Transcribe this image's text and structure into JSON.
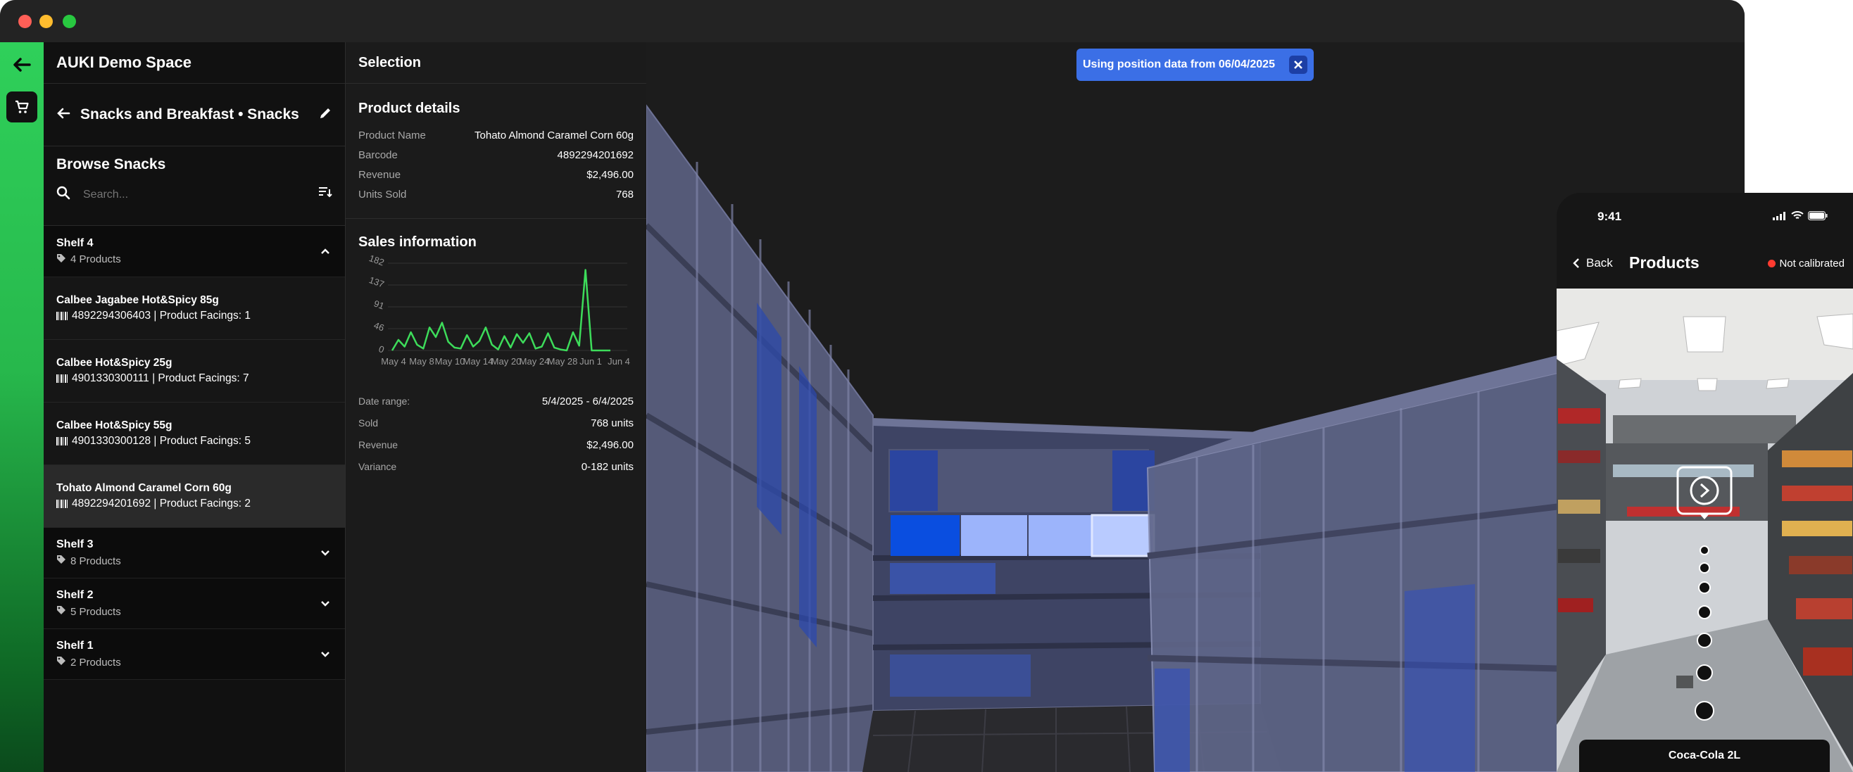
{
  "app": {
    "space_name": "AUKI Demo Space"
  },
  "category": {
    "title": "Snacks and Breakfast • Snacks"
  },
  "browse": {
    "title": "Browse Snacks",
    "search_placeholder": "Search..."
  },
  "shelves": [
    {
      "name": "Shelf 4",
      "count": "4 Products",
      "expanded": true,
      "products": [
        {
          "name": "Calbee Jagabee Hot&Spicy 85g",
          "meta": "4892294306403 | Product Facings: 1"
        },
        {
          "name": "Calbee Hot&Spicy 25g",
          "meta": "4901330300111 | Product Facings: 7"
        },
        {
          "name": "Calbee Hot&Spicy 55g",
          "meta": "4901330300128 | Product Facings: 5"
        },
        {
          "name": "Tohato Almond Caramel Corn 60g",
          "meta": "4892294201692 | Product Facings: 2"
        }
      ]
    },
    {
      "name": "Shelf 3",
      "count": "8 Products",
      "expanded": false
    },
    {
      "name": "Shelf 2",
      "count": "5 Products",
      "expanded": false
    },
    {
      "name": "Shelf 1",
      "count": "2 Products",
      "expanded": false
    }
  ],
  "selection": {
    "header": "Selection",
    "details_title": "Product details",
    "details": [
      {
        "k": "Product Name",
        "v": "Tohato Almond Caramel Corn 60g"
      },
      {
        "k": "Barcode",
        "v": "4892294201692"
      },
      {
        "k": "Revenue",
        "v": "$2,496.00"
      },
      {
        "k": "Units Sold",
        "v": "768"
      }
    ],
    "sales_title": "Sales information",
    "sales": [
      {
        "k": "Date range:",
        "v": "5/4/2025 - 6/4/2025"
      },
      {
        "k": "Sold",
        "v": "768 units"
      },
      {
        "k": "Revenue",
        "v": "$2,496.00"
      },
      {
        "k": "Variance",
        "v": "0-182 units"
      }
    ]
  },
  "chart_data": {
    "type": "line",
    "yticks": [
      "182",
      "137",
      "91",
      "46",
      "0"
    ],
    "xticks": [
      "May 4",
      "May 8",
      "May 10",
      "May 14",
      "May 20",
      "May 24",
      "May 28",
      "Jun 1",
      "Jun 4"
    ],
    "ylim": [
      0,
      182
    ],
    "series": [
      {
        "color": "#3ddc5a",
        "values": [
          0,
          22,
          8,
          38,
          12,
          4,
          48,
          28,
          58,
          18,
          6,
          4,
          32,
          8,
          20,
          48,
          12,
          2,
          30,
          6,
          34,
          16,
          36,
          4,
          8,
          36,
          6,
          2,
          0,
          38,
          10,
          168,
          0,
          0,
          0,
          0
        ]
      }
    ]
  },
  "viewport": {
    "toast": "Using position data from 06/04/2025"
  },
  "phone": {
    "time": "9:41",
    "back": "Back",
    "title": "Products",
    "calibration": "Not calibrated",
    "product_label": "Coca-Cola 2L"
  },
  "colors": {
    "accent_green": "#2fd05a",
    "toast_blue": "#3b6fe6",
    "highlight_blue": "#0a4ee0"
  }
}
